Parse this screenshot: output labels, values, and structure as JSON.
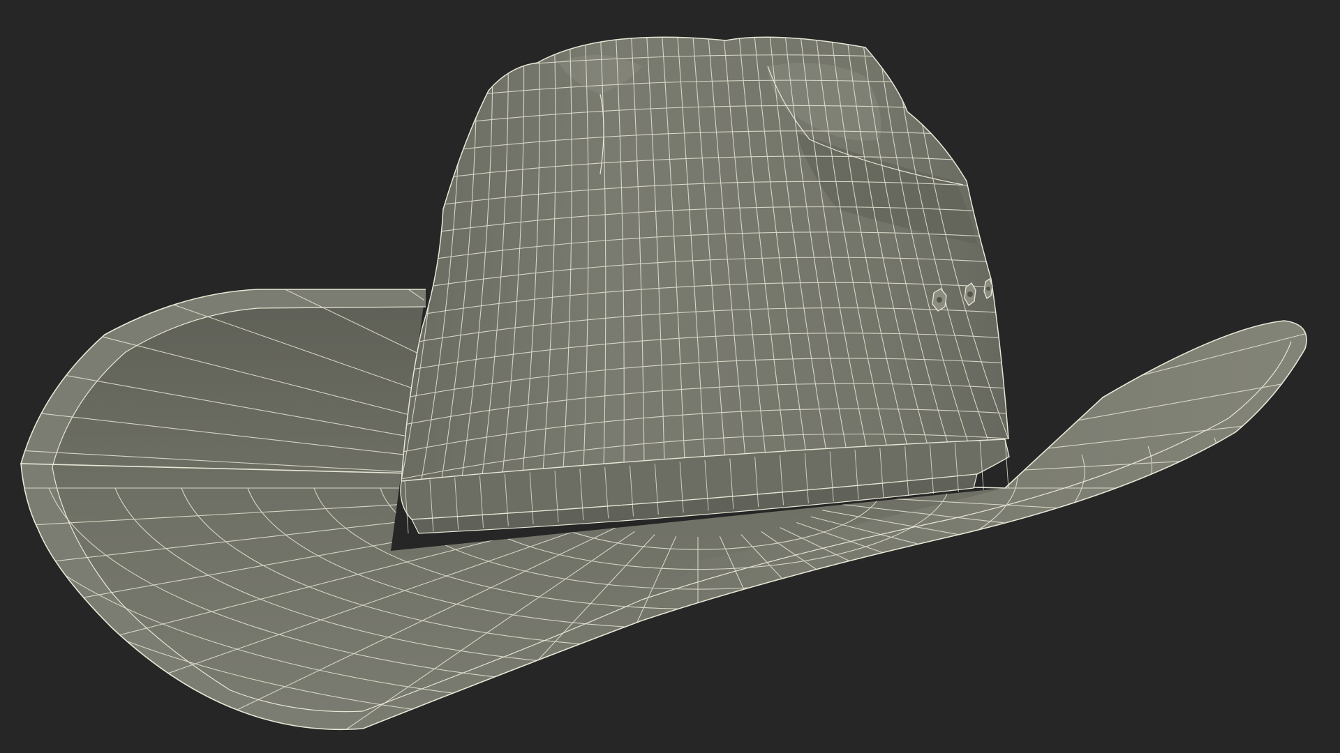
{
  "viewport": {
    "background": "#262626"
  },
  "model": {
    "subject": "cowboy-hat",
    "render_mode": "wireframe-on-shaded",
    "surface_color": "#74756a",
    "surface_dark": "#5b5c53",
    "surface_light": "#828377",
    "wire_color": "#e8e6d6"
  }
}
